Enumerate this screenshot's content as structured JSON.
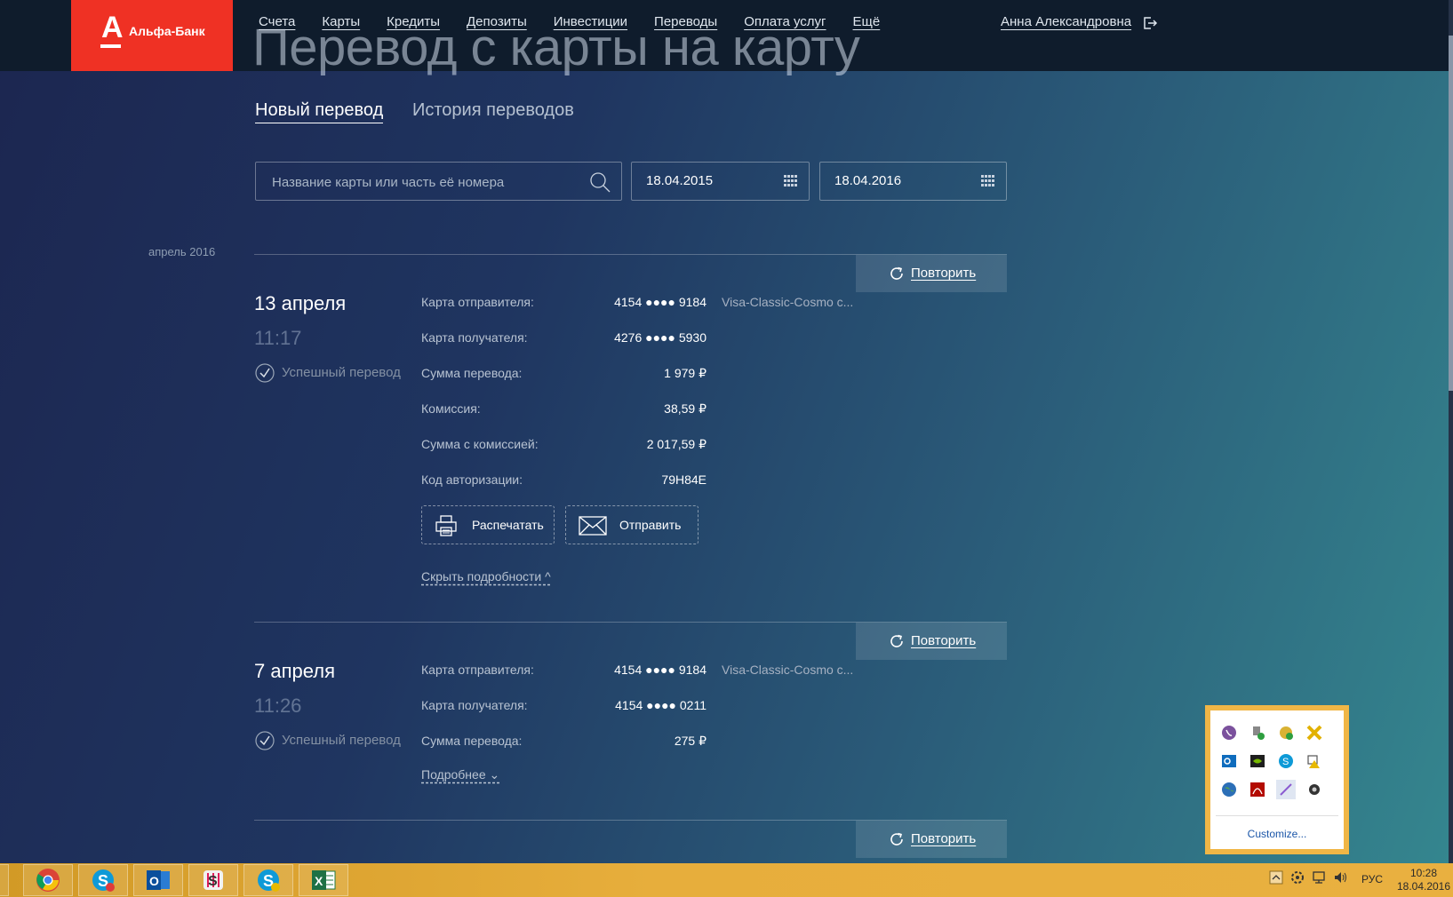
{
  "header": {
    "logo_text": "Альфа-Банк",
    "logo_letter": "А",
    "nav": [
      "Счета",
      "Карты",
      "Кредиты",
      "Депозиты",
      "Инвестиции",
      "Переводы",
      "Оплата услуг",
      "Ещё"
    ],
    "user_name": "Анна Александровна"
  },
  "page": {
    "title": "Перевод с карты на карту",
    "tabs": {
      "active": "Новый перевод",
      "inactive": "История переводов"
    },
    "filters": {
      "search_placeholder": "Название карты или часть её номера",
      "date_from": "18.04.2015",
      "date_to": "18.04.2016"
    },
    "month_label": "апрель 2016",
    "repeat_label": "Повторить"
  },
  "transfers": [
    {
      "date": "13 апреля",
      "time": "11:17",
      "status": "Успешный перевод",
      "card_name": "Visa-Classic-Cosmo с...",
      "rows": [
        {
          "label": "Карта отправителя:",
          "value": "4154 ●●●● 9184"
        },
        {
          "label": "Карта получателя:",
          "value": "4276 ●●●● 5930"
        },
        {
          "label": "Сумма перевода:",
          "value": "1 979 ₽"
        },
        {
          "label": "Комиссия:",
          "value": "38,59 ₽"
        },
        {
          "label": "Сумма с комиссией:",
          "value": "2 017,59 ₽"
        },
        {
          "label": "Код авторизации:",
          "value": "79H84E"
        }
      ],
      "print_label": "Распечатать",
      "send_label": "Отправить",
      "toggle_label": "Скрыть подробности ^"
    },
    {
      "date": "7 апреля",
      "time": "11:26",
      "status": "Успешный перевод",
      "card_name": "Visa-Classic-Cosmo с...",
      "rows": [
        {
          "label": "Карта отправителя:",
          "value": "4154 ●●●● 9184"
        },
        {
          "label": "Карта получателя:",
          "value": "4154 ●●●● 0211"
        },
        {
          "label": "Сумма перевода:",
          "value": "275 ₽"
        }
      ],
      "toggle_label": "Подробнее ⌄"
    }
  ],
  "tray_popup": {
    "customize_label": "Customize..."
  },
  "taskbar": {
    "apps": [
      "viber-icon",
      "chrome-icon",
      "skype-icon",
      "outlook-icon",
      "slack-icon",
      "skype-icon",
      "excel-icon"
    ],
    "lang": "РУС",
    "time": "10:28",
    "date": "18.04.2016"
  },
  "colors": {
    "brand": "#ef3124",
    "topbar": "#0f1c2c",
    "taskbar": "#e3a938"
  }
}
